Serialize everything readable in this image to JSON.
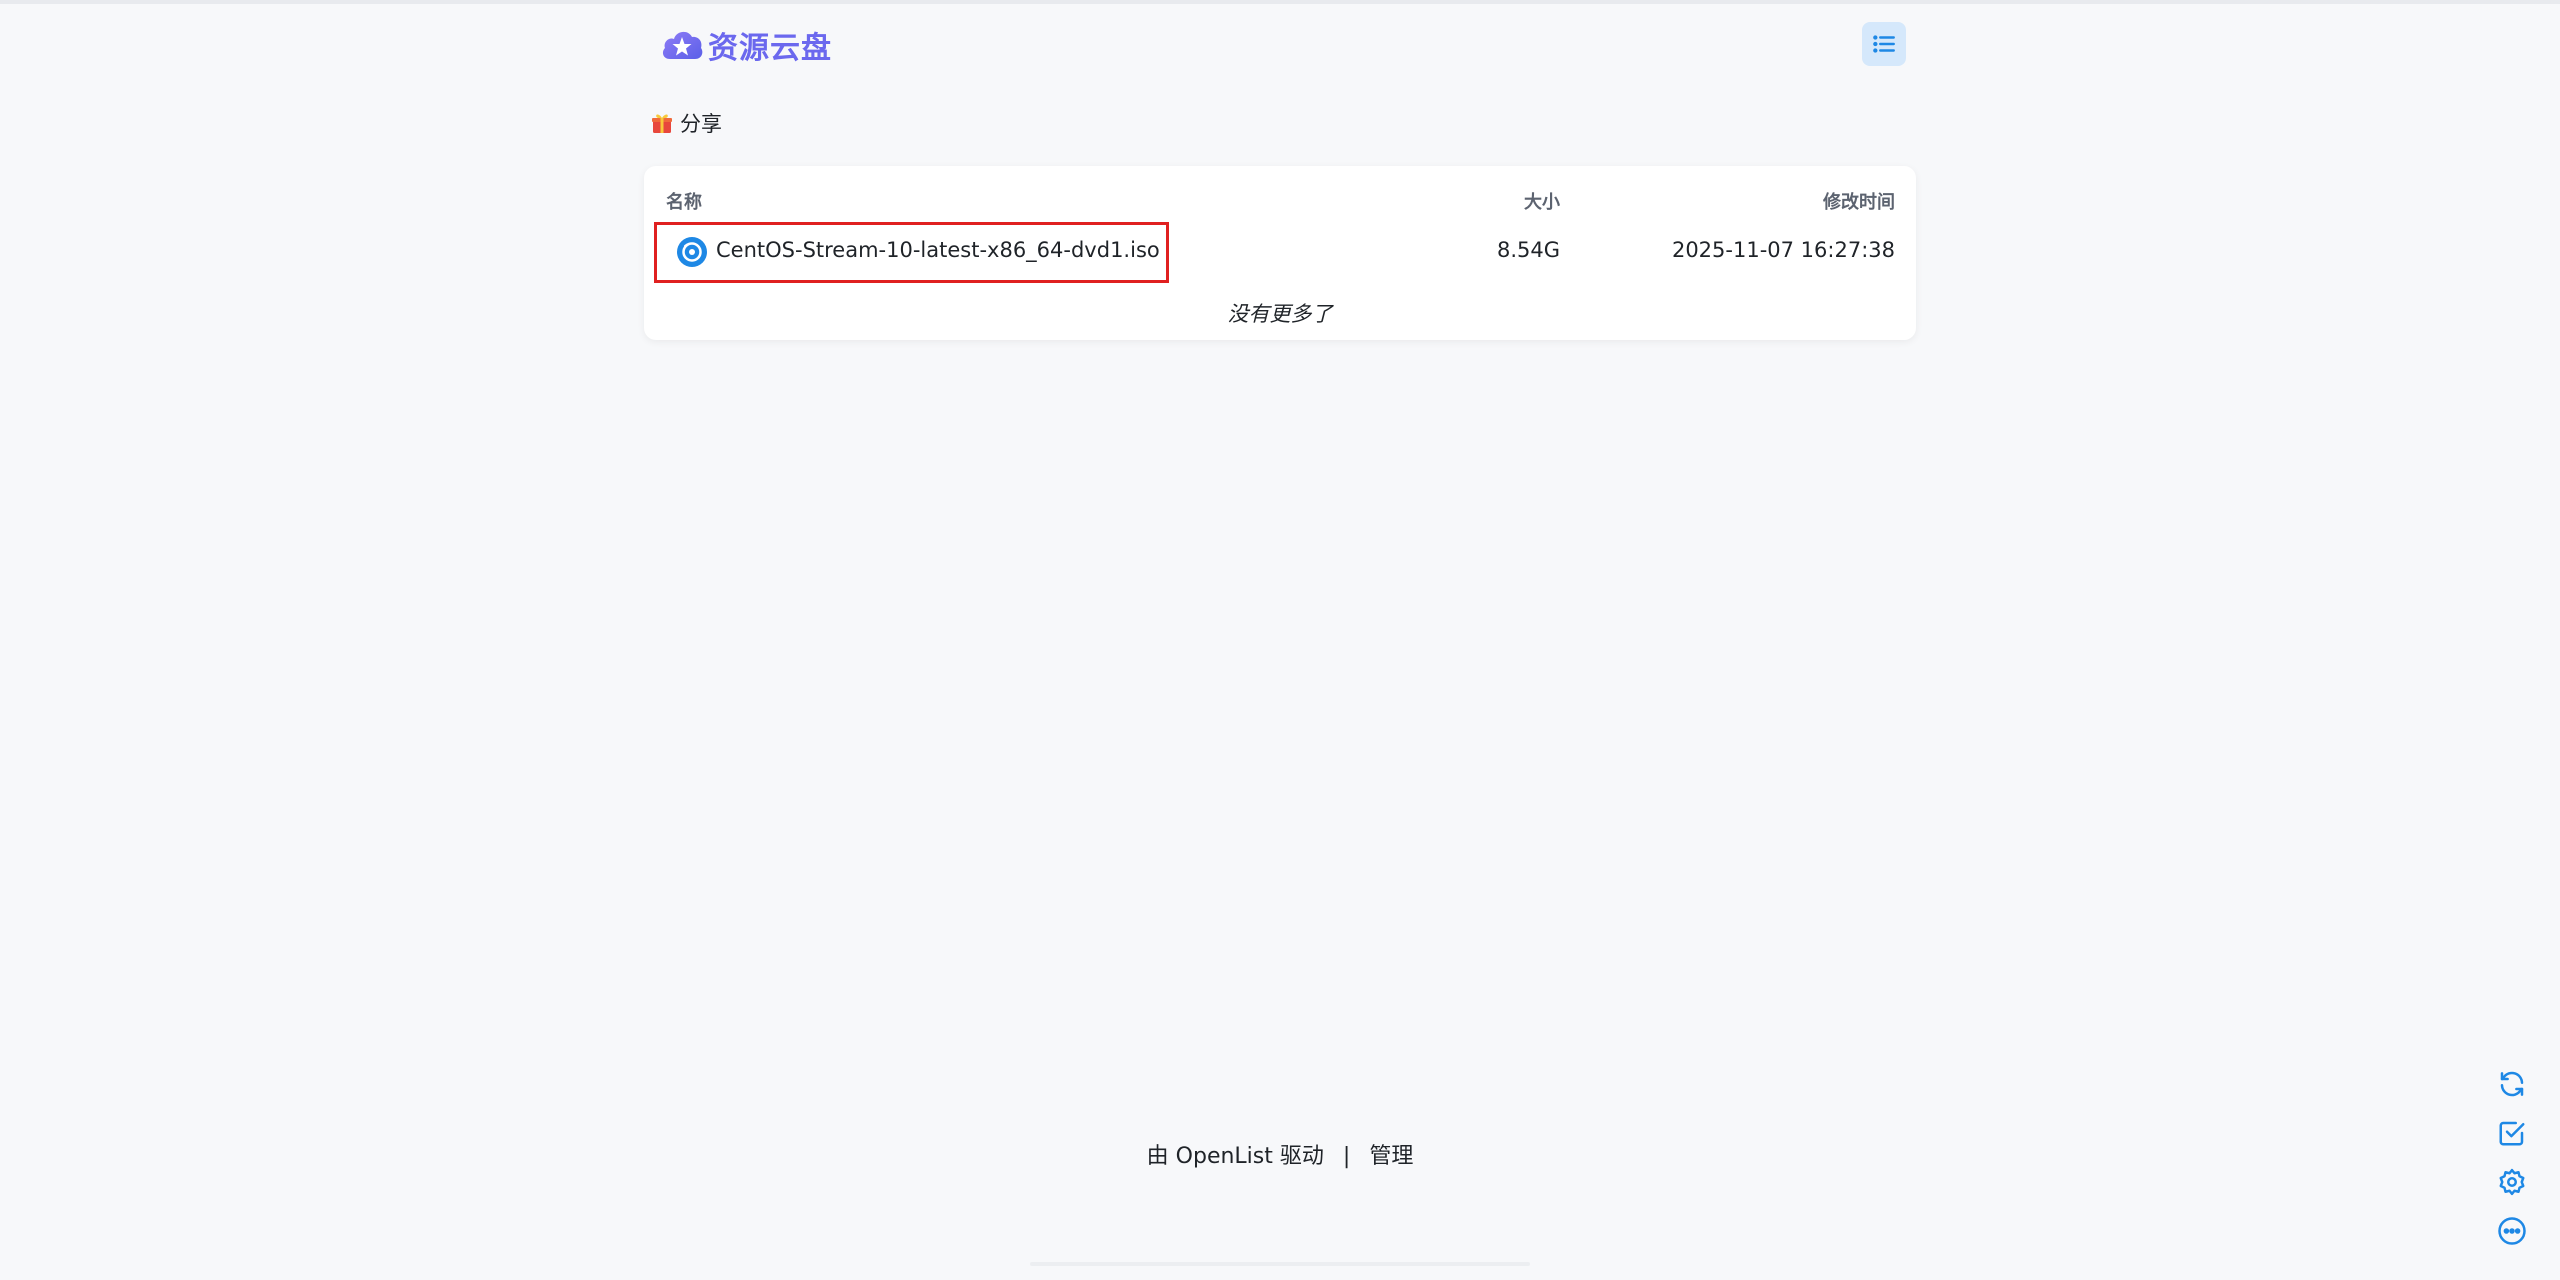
{
  "header": {
    "logo_text": "资源云盘",
    "logo_icon": "cloud-star-icon",
    "menu_icon": "list-icon"
  },
  "breadcrumb": {
    "icon": "gift-icon",
    "label": "分享"
  },
  "file_list": {
    "columns": {
      "name": "名称",
      "size": "大小",
      "modified": "修改时间"
    },
    "rows": [
      {
        "icon": "disc-icon",
        "name": "CentOS-Stream-10-latest-x86_64-dvd1.iso",
        "size": "8.54G",
        "modified": "2025-11-07 16:27:38"
      }
    ],
    "end_text": "没有更多了"
  },
  "footer": {
    "powered_by": "由 OpenList 驱动",
    "separator": "|",
    "admin_link": "管理"
  },
  "side_tools": [
    "refresh-icon",
    "check-square-icon",
    "settings-icon",
    "more-icon"
  ],
  "colors": {
    "accent": "#1e88e5",
    "logo": "#6b68ee",
    "highlight_box": "#e02020",
    "background": "#f7f8fa"
  }
}
